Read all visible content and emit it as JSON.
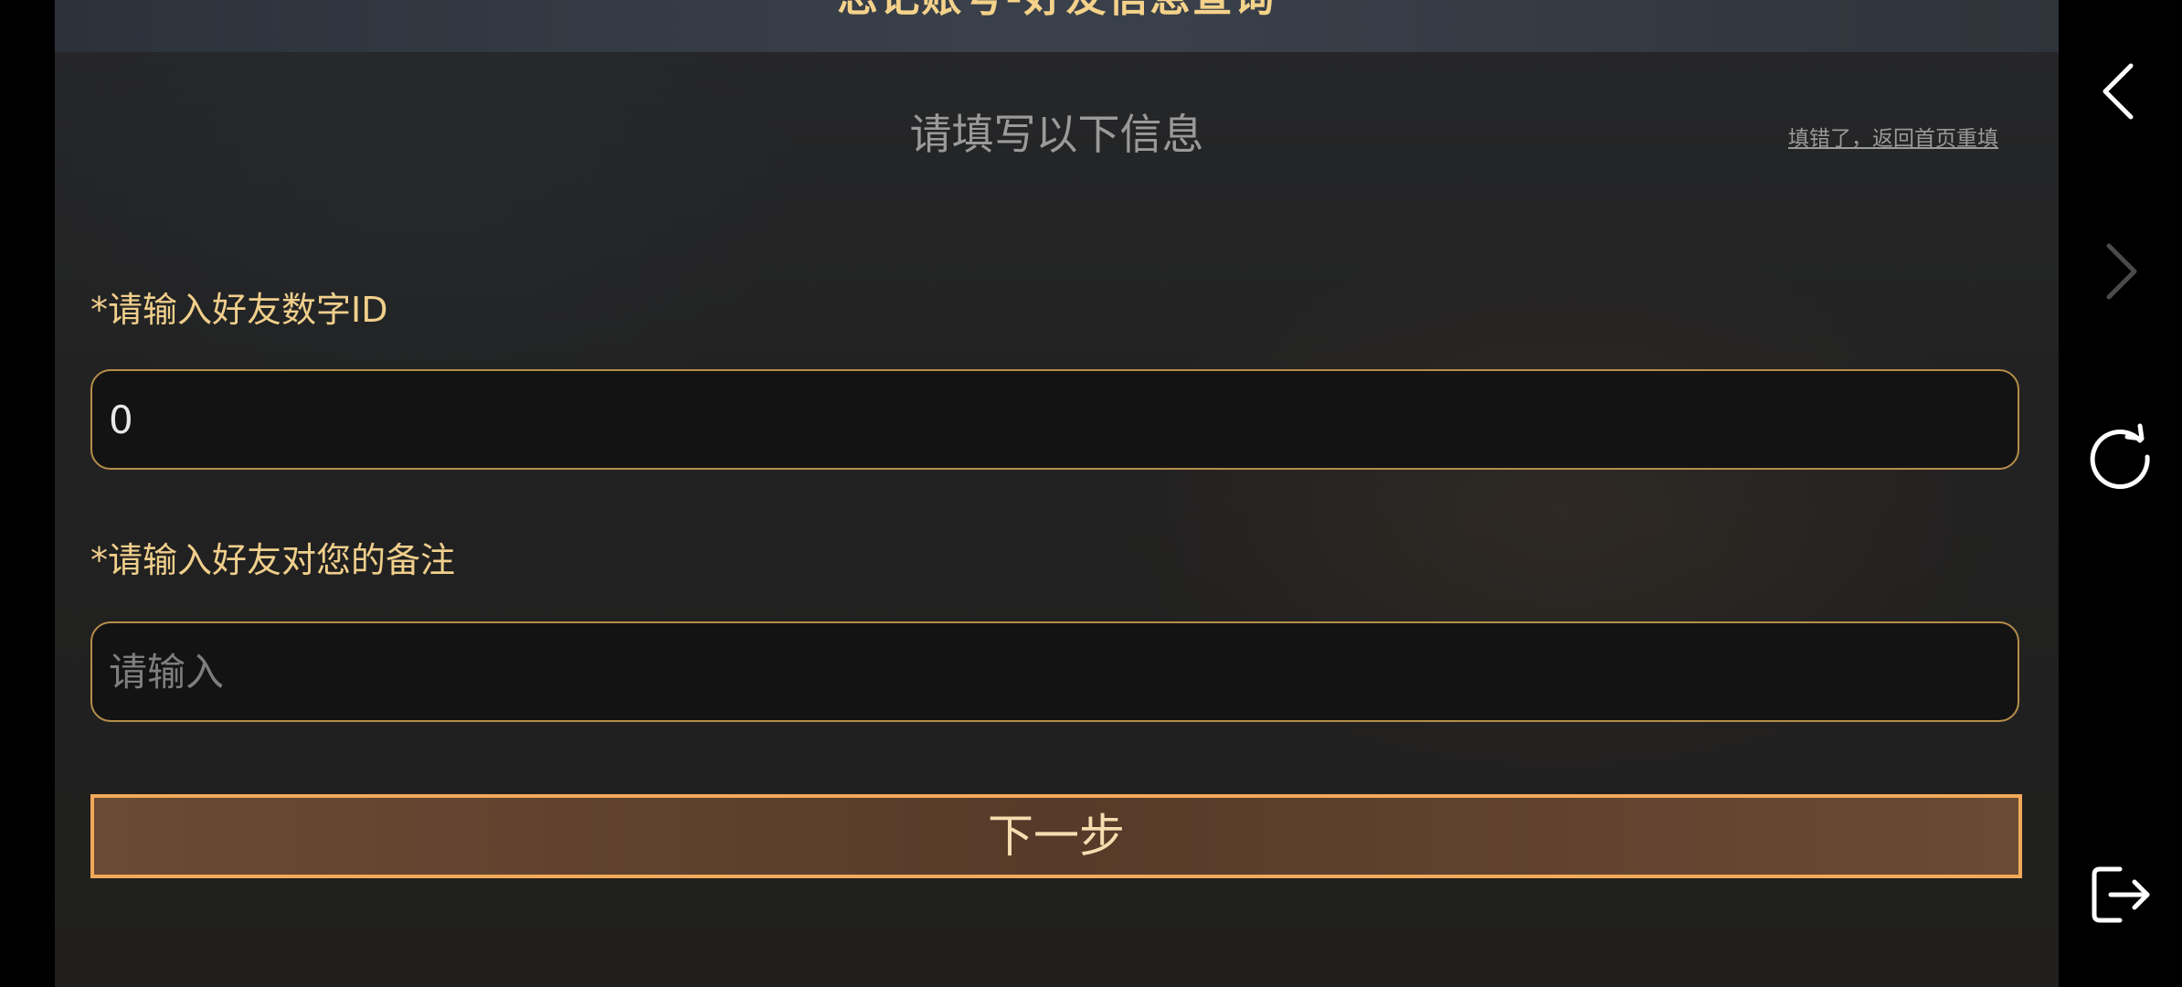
{
  "header": {
    "title": "忘记账号-好友信息查询"
  },
  "form": {
    "heading": "请填写以下信息",
    "reset_link": "填错了，返回首页重填",
    "friend_id": {
      "label": "*请输入好友数字ID",
      "value": "0"
    },
    "remark": {
      "label": "*请输入好友对您的备注",
      "placeholder": "请输入",
      "value": ""
    },
    "next_label": "下一步"
  },
  "nav": {
    "icons": [
      "back-icon",
      "forward-icon",
      "refresh-icon",
      "exit-icon"
    ]
  },
  "colors": {
    "accent": "#f0cf8c",
    "button_border": "#f2a95a",
    "input_border": "#b58e4a",
    "background": "#232323"
  }
}
